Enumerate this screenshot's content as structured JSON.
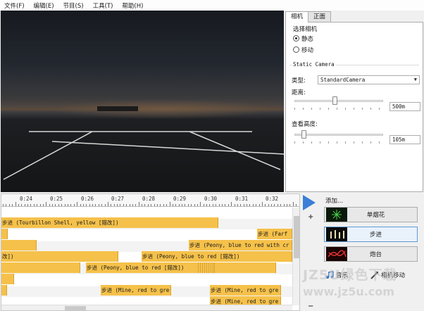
{
  "menu": [
    "文件(F)",
    "编辑(E)",
    "节目(S)",
    "工具(T)",
    "帮助(H)"
  ],
  "panel": {
    "tabs": [
      "相机",
      "正面"
    ],
    "select_camera_label": "选择相机",
    "radio_static": "静态",
    "radio_moving": "移动",
    "group_title": "Static Camera",
    "type_label": "类型:",
    "type_value": "StandardCamera",
    "distance_label": "距离:",
    "distance_value": "500m",
    "distance_fraction": 0.45,
    "height_label": "查看高度:",
    "height_value": "105m",
    "height_fraction": 0.1
  },
  "ruler": [
    "0:24",
    "0:25",
    "0:26",
    "0:27",
    "0:28",
    "0:29",
    "0:30",
    "0:31",
    "0:32"
  ],
  "events": [
    {
      "row": 0,
      "text": "步进 (Tourbillon Shell, yellow [錯改])",
      "hatch": false
    },
    {
      "row": 1,
      "text": "步进 (Farf",
      "hatch": false
    },
    {
      "row": 2,
      "text": "步进 (Peony, blue to red with cr",
      "hatch": false
    },
    {
      "row": 3,
      "text": "改])",
      "hatch": false
    },
    {
      "row": 3,
      "text": "步进 (Peony, blue to red [錯改])",
      "hatch": false
    },
    {
      "row": 4,
      "text": "步进 (Peony, blue to red [錯改])",
      "hatch": true
    },
    {
      "row": 6,
      "text": "步进 (Mine, red to gre",
      "hatch": false
    },
    {
      "row": 6,
      "text": "步进 (Mine, red to gre",
      "hatch": false
    },
    {
      "row": 7,
      "text": "步进 (Mine, red to gre",
      "hatch": false
    }
  ],
  "add": {
    "title": "添加...",
    "buttons": [
      "单烟花",
      "步进",
      "炮台"
    ],
    "selected": "步进",
    "music": "音乐",
    "camera_move": "相机移动"
  },
  "watermark": [
    "JZ5U绿色下载",
    "www.jz5u.com"
  ],
  "colors": {
    "event": "#f5c14a",
    "accent": "#3a7ed8",
    "selection": "#5b9bd5"
  }
}
